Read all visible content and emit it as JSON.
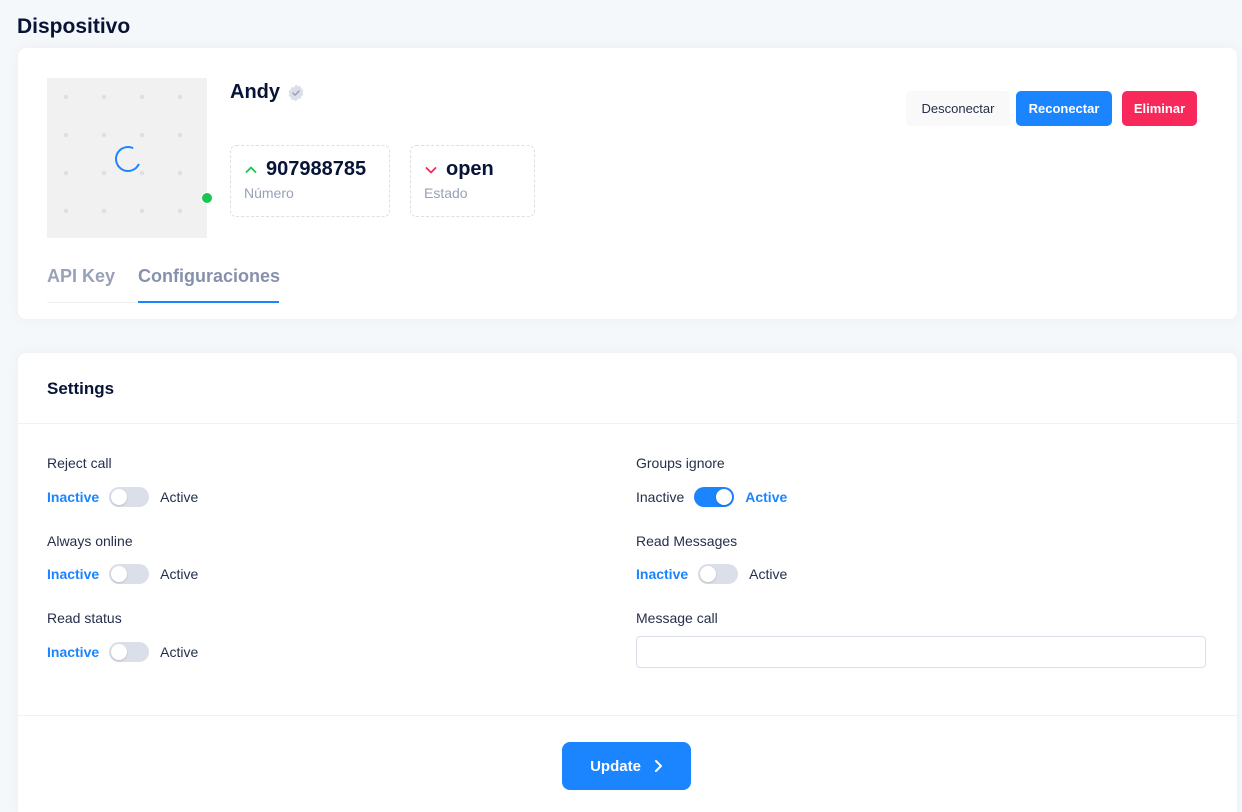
{
  "page": {
    "title": "Dispositivo"
  },
  "device": {
    "name": "Andy",
    "stats": [
      {
        "value": "907988785",
        "label": "Número",
        "trend": "up"
      },
      {
        "value": "open",
        "label": "Estado",
        "trend": "down"
      }
    ],
    "online": true
  },
  "actions": {
    "disconnect": "Desconectar",
    "reconnect": "Reconectar",
    "delete": "Eliminar"
  },
  "tabs": [
    {
      "label": "API Key",
      "active": false
    },
    {
      "label": "Configuraciones",
      "active": true
    }
  ],
  "settings": {
    "title": "Settings",
    "left": [
      {
        "label": "Reject call",
        "off": "Inactive",
        "on": "Active",
        "enabled": false
      },
      {
        "label": "Always online",
        "off": "Inactive",
        "on": "Active",
        "enabled": false
      },
      {
        "label": "Read status",
        "off": "Inactive",
        "on": "Active",
        "enabled": false
      }
    ],
    "right": [
      {
        "label": "Groups ignore",
        "off": "Inactive",
        "on": "Active",
        "enabled": true
      },
      {
        "label": "Read Messages",
        "off": "Inactive",
        "on": "Active",
        "enabled": false
      }
    ],
    "message_call": {
      "label": "Message call",
      "value": ""
    },
    "update_label": "Update"
  },
  "colors": {
    "primary": "#1b84ff",
    "danger": "#f8285a",
    "success": "#17c653"
  },
  "icons": {
    "verified": "verified-badge-icon",
    "spinner": "loading-spinner-icon",
    "up": "arrow-up-icon",
    "down": "arrow-down-icon",
    "chevron": "chevron-right-icon"
  }
}
